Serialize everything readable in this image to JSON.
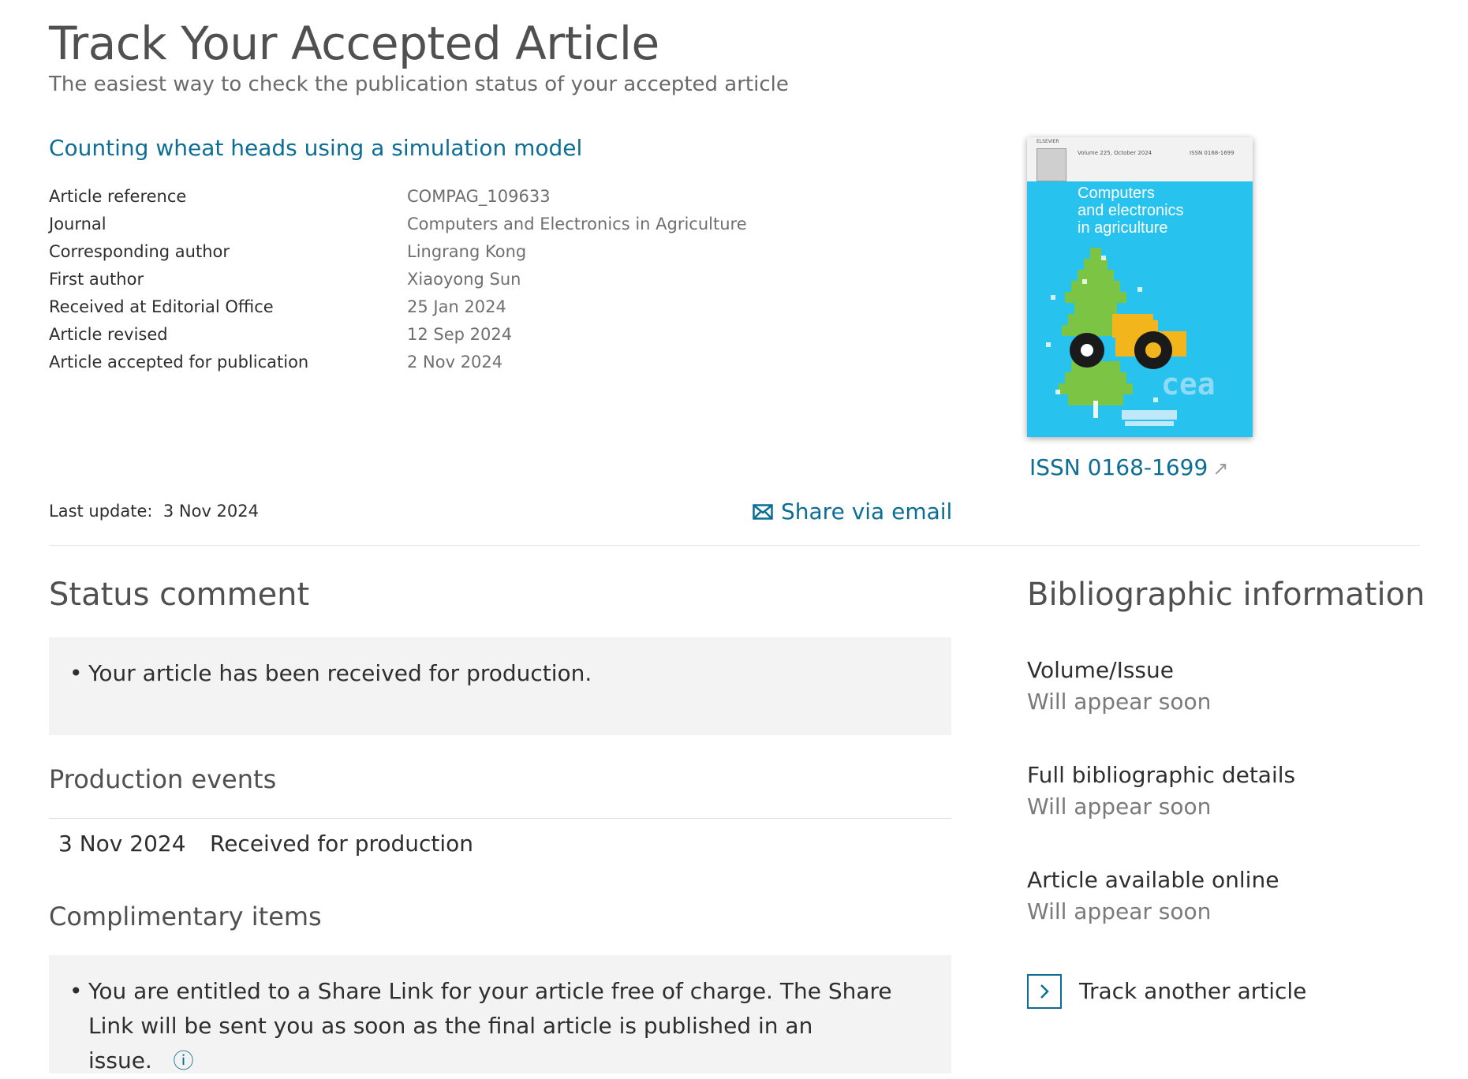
{
  "page": {
    "title": "Track Your Accepted Article",
    "subtitle": "The easiest way to check the publication status of your accepted article"
  },
  "article": {
    "title": "Counting wheat heads using a simulation model",
    "details": [
      {
        "label": "Article reference",
        "value": "COMPAG_109633"
      },
      {
        "label": "Journal",
        "value": "Computers and Electronics in Agriculture"
      },
      {
        "label": "Corresponding author",
        "value": "Lingrang Kong"
      },
      {
        "label": "First author",
        "value": "Xiaoyong Sun"
      },
      {
        "label": "Received at Editorial Office",
        "value": "25 Jan 2024"
      },
      {
        "label": "Article revised",
        "value": "12 Sep 2024"
      },
      {
        "label": "Article accepted for publication",
        "value": "2 Nov 2024"
      }
    ],
    "last_update_label": "Last update:",
    "last_update_value": "3 Nov 2024",
    "share_label": "Share via email"
  },
  "journal_cover": {
    "top_left_text": "Volume 225, October 2024",
    "top_right_text": "ISSN 0168-1699",
    "publisher": "ELSEVIER",
    "title_lines": [
      "Computers",
      "and electronics",
      "in agriculture"
    ],
    "cea_text": "cea",
    "issn_link": "ISSN 0168-1699",
    "issn_arrow": "↗",
    "colors": {
      "cover_bg": "#27c3ee",
      "tree": "#7cc443",
      "tractor": "#f2b51c"
    }
  },
  "status": {
    "heading": "Status comment",
    "comments": [
      "Your article has been received for production."
    ]
  },
  "production": {
    "heading": "Production events",
    "events": [
      {
        "date": "3 Nov 2024",
        "event": "Received for production"
      }
    ]
  },
  "complimentary": {
    "heading": "Complimentary items",
    "items": [
      "You are entitled to a Share Link for your article free of charge. The Share Link will be sent you as soon as the final article is published in an issue."
    ],
    "info_icon": "ⓘ"
  },
  "bibliographic": {
    "heading": "Bibliographic information",
    "items": [
      {
        "label": "Volume/Issue",
        "value": "Will appear soon"
      },
      {
        "label": "Full bibliographic details",
        "value": "Will appear soon"
      },
      {
        "label": "Article available online",
        "value": "Will appear soon"
      }
    ],
    "track_another_label": "Track another article"
  },
  "colors": {
    "link": "#0c6e94",
    "heading": "#505050",
    "text": "#2e2e2e",
    "muted": "#6f6f6f",
    "box_bg": "#f3f3f3"
  }
}
